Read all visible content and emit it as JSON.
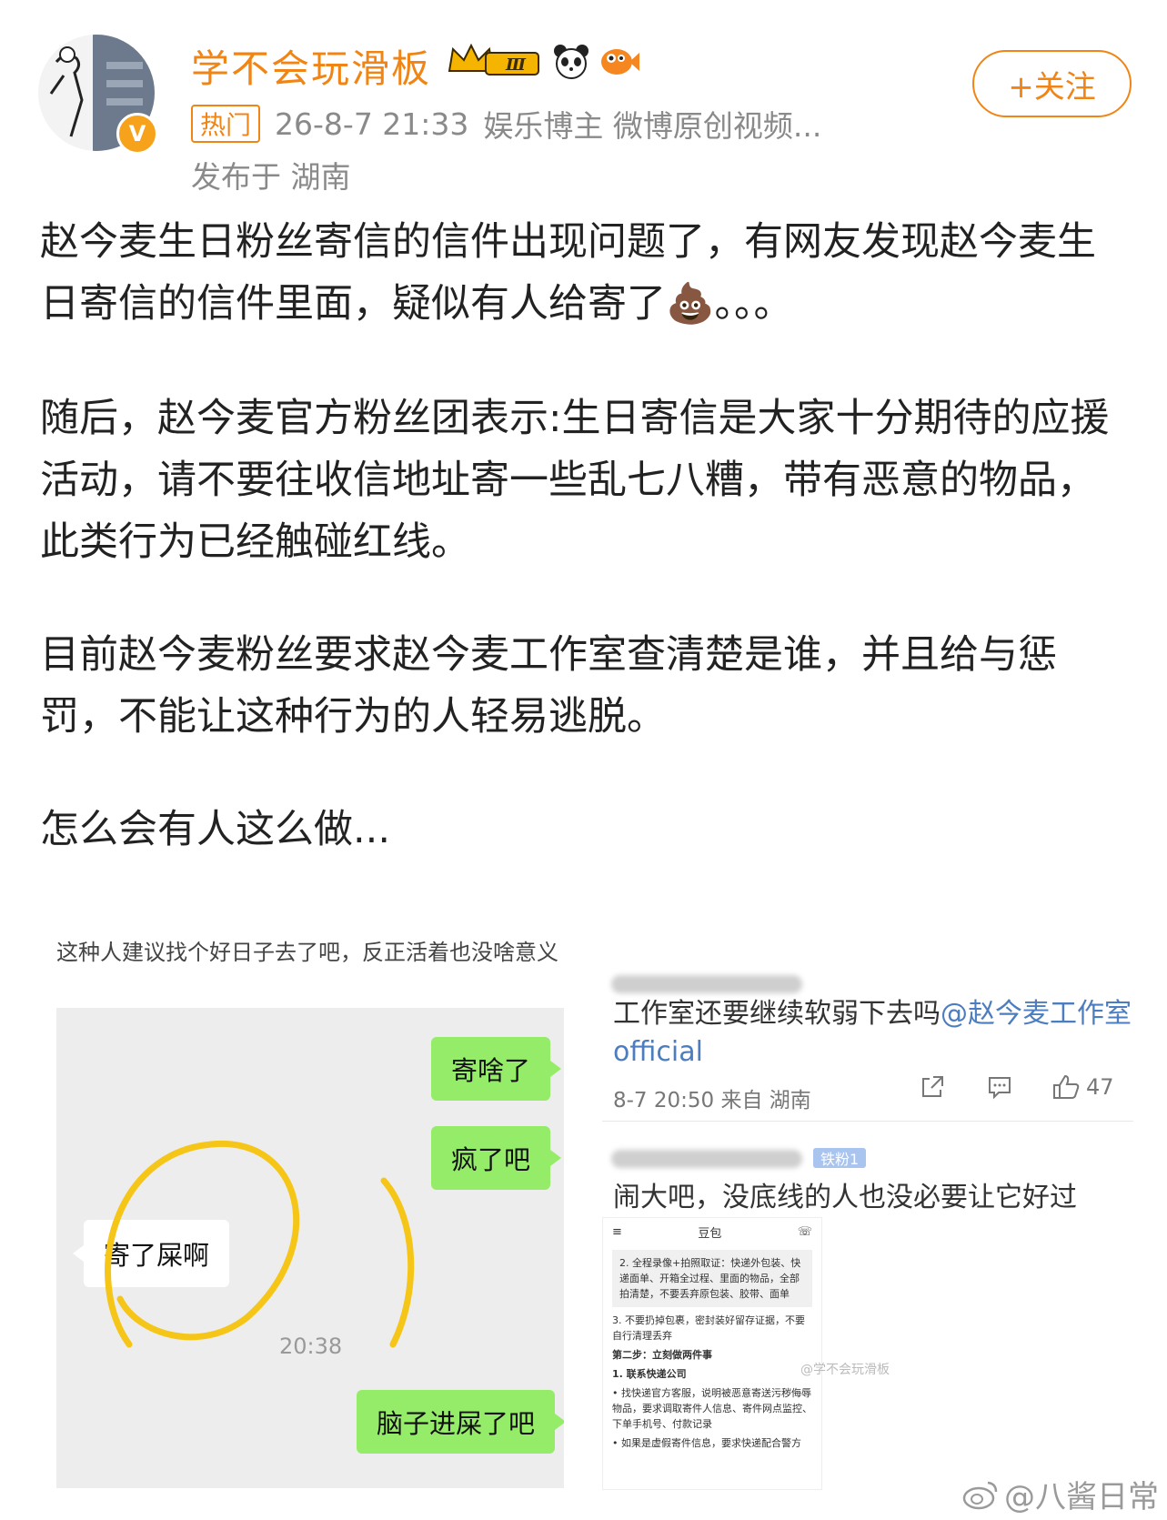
{
  "post": {
    "username": "学不会玩滑板",
    "follow_label": "+关注",
    "hot_tag": "热门",
    "timestamp": "26-8-7 21:33",
    "source": "娱乐博主 微博原创视频...",
    "location": "发布于 湖南",
    "level_badge": "Ⅲ",
    "verified_badge": "V",
    "paragraphs": [
      "赵今麦生日粉丝寄信的信件出现问题了，有网友发现赵今麦生日寄信的信件里面，疑似有人给寄了💩。。。",
      "随后，赵今麦官方粉丝团表示:生日寄信是大家十分期待的应援活动，请不要往收信地址寄一些乱七八糟，带有恶意的物品，此类行为已经触碰红线。",
      "目前赵今麦粉丝要求赵今麦工作室查清楚是谁，并且给与惩罚，不能让这种行为的人轻易逃脱。",
      "怎么会有人这么做..."
    ]
  },
  "left_image": {
    "caption": "这种人建议找个好日子去了吧，反正活着也没啥意义",
    "messages": [
      {
        "side": "right",
        "text": "寄啥了"
      },
      {
        "side": "right",
        "text": "疯了吧"
      },
      {
        "side": "left",
        "text": "寄了屎啊"
      },
      {
        "side": "right",
        "text": "脑子进屎了吧"
      }
    ],
    "time": "20:38"
  },
  "right_image": {
    "comment1": {
      "text": "工作室还要继续软弱下去吗",
      "mention": "@赵今麦工作室official",
      "meta": "8-7 20:50 来自 湖南",
      "likes": "47"
    },
    "comment2": {
      "fan_tag": "铁粉1",
      "text": "闹大吧，没底线的人也没必要让它好过"
    },
    "phone_screenshot": {
      "title": "豆包",
      "lines": [
        "2. 全程录像+拍照取证：快递外包装、快递面单、开箱全过程、里面的物品，全部拍清楚，不要丢弃原包装、胶带、面单",
        "3. 不要扔掉包裹，密封装好留存证据，不要自行清理丢弃",
        "第二步：立刻做两件事",
        "1. 联系快递公司",
        "• 找快递官方客服，说明被恶意寄送污秽侮辱物品，要求调取寄件人信息、寄件网点监控、下单手机号、付款记录",
        "• 如果是虚假寄件信息，要求快递配合警方"
      ],
      "watermark": "@学不会玩滑板"
    }
  },
  "footer": {
    "watermark": "@八酱日常"
  }
}
